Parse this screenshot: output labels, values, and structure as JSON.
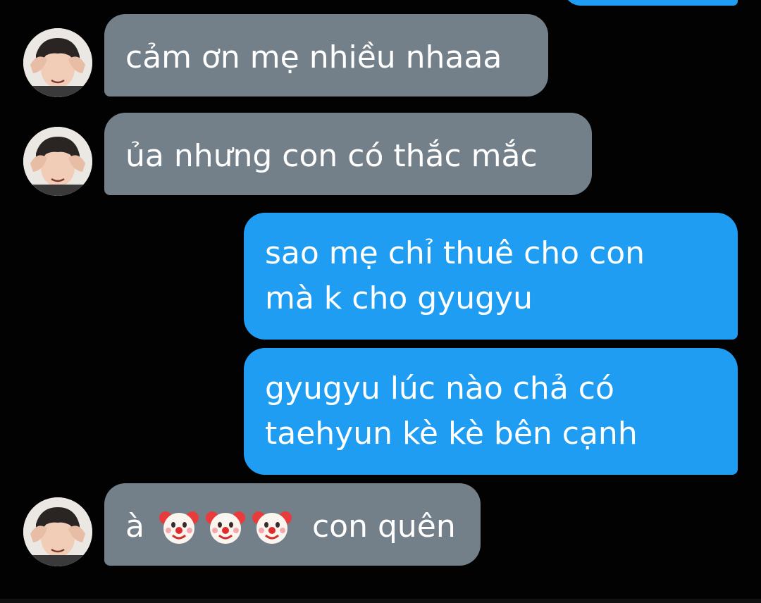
{
  "messages": [
    {
      "sender": "other",
      "lines": [
        "cảm ơn mẹ nhiều nhaaa"
      ]
    },
    {
      "sender": "other",
      "lines": [
        "ủa nhưng con có thắc mắc"
      ]
    },
    {
      "sender": "me",
      "lines": [
        "sao mẹ chỉ thuê cho con",
        "mà k cho gyugyu"
      ]
    },
    {
      "sender": "me",
      "lines": [
        "gyugyu lúc nào chả có",
        "taehyun kè kè bên cạnh"
      ]
    },
    {
      "sender": "other",
      "prefix": "à",
      "emoji": [
        "clown-face-icon",
        "clown-face-icon",
        "clown-face-icon"
      ],
      "suffix": "con quên"
    }
  ],
  "colors": {
    "background": "#020202",
    "incoming_bubble": "#73808a",
    "outgoing_bubble": "#1f9df3",
    "text": "#ffffff"
  }
}
